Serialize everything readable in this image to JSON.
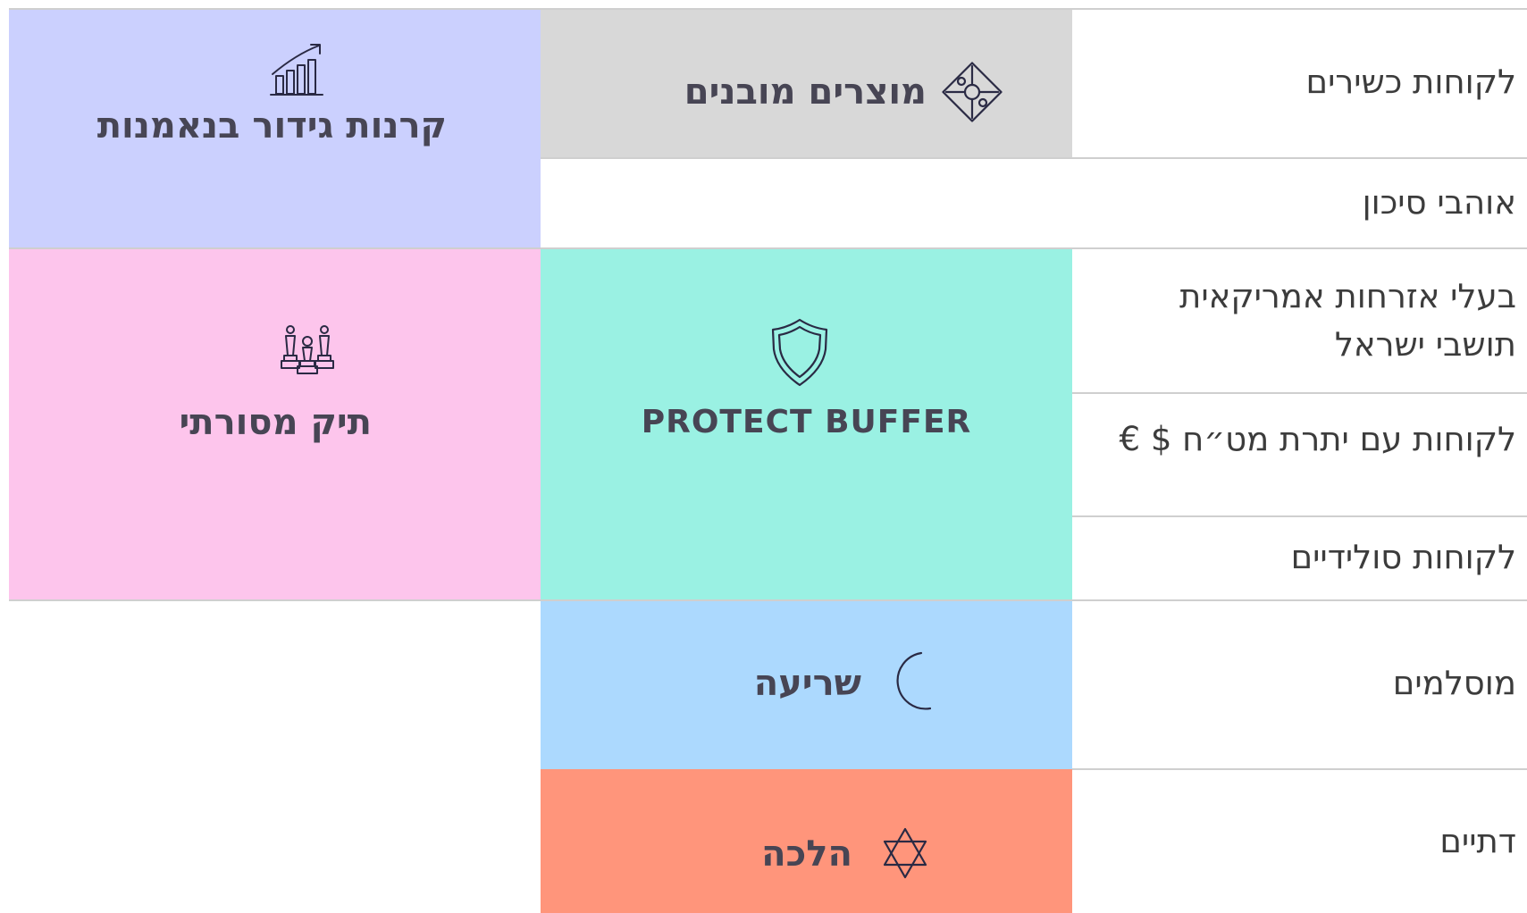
{
  "colors": {
    "structured": "#d8d8d8",
    "hedge": "#cbd0fe",
    "traditional": "#fdc5ec",
    "protect": "#9af1e3",
    "sharia": "#acd9fe",
    "halacha": "#ff957b",
    "divider": "#cfcfcf",
    "icon_stroke": "#2a2a44"
  },
  "segments": [
    {
      "label": "לקוחות כשירים"
    },
    {
      "label": "אוהבי סיכון"
    },
    {
      "label_line1": "בעלי אזרחות אמריקאית",
      "label_line2": "תושבי ישראל"
    },
    {
      "label": "לקוחות עם יתרת מט״ח $ €"
    },
    {
      "label": "לקוחות סולידיים"
    },
    {
      "label": "מוסלמים"
    },
    {
      "label": "דתיים"
    }
  ],
  "products": {
    "structured": {
      "title": "מוצרים מובנים",
      "icon": "puzzle-icon"
    },
    "hedge": {
      "title": "קרנות גידור בנאמנות",
      "icon": "growth-chart-icon"
    },
    "traditional": {
      "title": "תיק מסורתי",
      "icon": "chess-pieces-icon"
    },
    "protect": {
      "title": "PROTECT BUFFER",
      "icon": "shield-icon"
    },
    "sharia": {
      "title": "שריעה",
      "icon": "crescent-moon-icon"
    },
    "halacha": {
      "title": "הלכה",
      "icon": "star-of-david-icon"
    }
  }
}
